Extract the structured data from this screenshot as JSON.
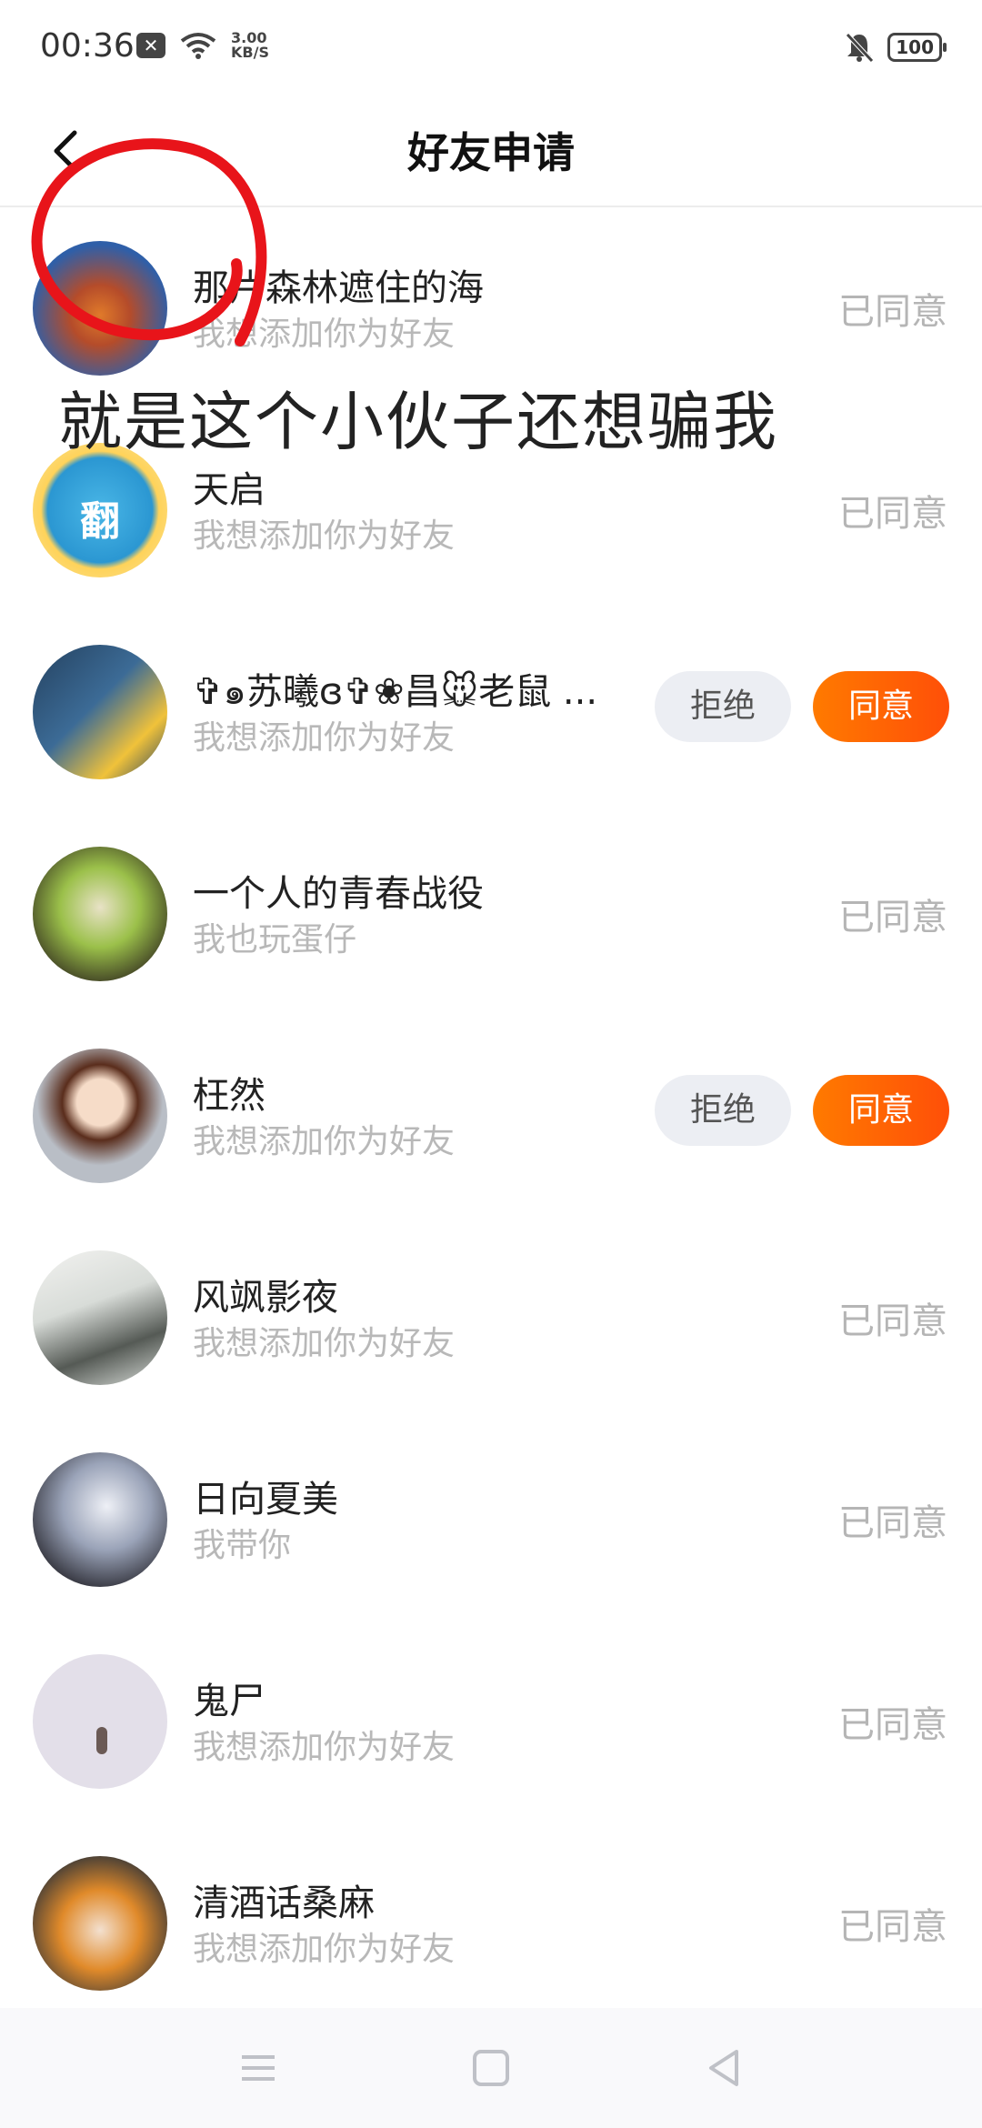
{
  "status_bar": {
    "time": "00:36",
    "net_speed_value": "3.00",
    "net_speed_unit": "KB/S",
    "battery": "100"
  },
  "header": {
    "title": "好友申请"
  },
  "requests": [
    {
      "name": "那片森林遮住的海",
      "message": "我想添加你为好友",
      "status": "已同意",
      "avatar_colors": [
        "#2f5fa8",
        "#e07a2a"
      ]
    },
    {
      "name": "天启",
      "message": "我想添加你为好友",
      "status": "已同意",
      "avatar_colors": [
        "#49b6e6",
        "#ffd35a"
      ]
    },
    {
      "name": "✞๑苏曦ɞ✞❀昌🐭老鼠 ...",
      "message": "我想添加你为好友",
      "reject_label": "拒绝",
      "accept_label": "同意",
      "avatar_colors": [
        "#24415f",
        "#f0c23a"
      ]
    },
    {
      "name": "一个人的青春战役",
      "message": "我也玩蛋仔",
      "status": "已同意",
      "avatar_colors": [
        "#3b3a22",
        "#9bc04a"
      ]
    },
    {
      "name": "枉然",
      "message": "我想添加你为好友",
      "reject_label": "拒绝",
      "accept_label": "同意",
      "avatar_colors": [
        "#b9bec6",
        "#5a2d1c"
      ]
    },
    {
      "name": "风飒影夜",
      "message": "我想添加你为好友",
      "status": "已同意",
      "avatar_colors": [
        "#d8dcd8",
        "#555a55"
      ]
    },
    {
      "name": "日向夏美",
      "message": "我带你",
      "status": "已同意",
      "avatar_colors": [
        "#9aa3b8",
        "#2c2c34"
      ]
    },
    {
      "name": "鬼尸",
      "message": "我想添加你为好友",
      "status": "已同意",
      "avatar_colors": [
        "#e3dfe9",
        "#cfc6dc"
      ]
    },
    {
      "name": "清酒话桑麻",
      "message": "我想添加你为好友",
      "status": "已同意",
      "avatar_colors": [
        "#4a4036",
        "#e08a2a"
      ]
    }
  ],
  "annotation": {
    "text": "就是这个小伙子还想骗我",
    "circle_color": "#e8141a"
  },
  "colors": {
    "accent": "#ff5a06",
    "muted_text": "#b8b8b8"
  }
}
